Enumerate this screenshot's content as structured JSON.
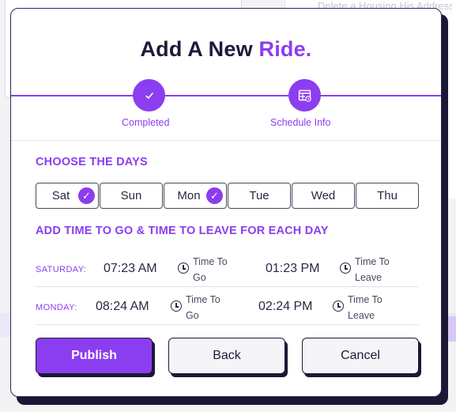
{
  "background": {
    "ghost_text": "Delete a Housing His Address"
  },
  "modal": {
    "title_main": "Add A New",
    "title_accent": "Ride.",
    "steps": [
      {
        "label": "Completed",
        "icon": "check-icon"
      },
      {
        "label": "Schedule Info",
        "icon": "calendar-schedule-icon"
      }
    ],
    "days_heading": "CHOOSE THE DAYS",
    "days": [
      {
        "label": "Sat",
        "selected": true
      },
      {
        "label": "Sun",
        "selected": false
      },
      {
        "label": "Mon",
        "selected": true
      },
      {
        "label": "Tue",
        "selected": false
      },
      {
        "label": "Wed",
        "selected": false
      },
      {
        "label": "Thu",
        "selected": false
      }
    ],
    "times_heading": "ADD TIME TO GO & TIME TO LEAVE FOR EACH DAY",
    "schedule": [
      {
        "day": "SATURDAY:",
        "go_time": "07:23 AM",
        "go_label": "Time To Go",
        "leave_time": "01:23 PM",
        "leave_label": "Time To Leave"
      },
      {
        "day": "MONDAY:",
        "go_time": "08:24 AM",
        "go_label": "Time To Go",
        "leave_time": "02:24 PM",
        "leave_label": "Time To Leave"
      }
    ],
    "buttons": {
      "publish": "Publish",
      "back": "Back",
      "cancel": "Cancel"
    }
  },
  "colors": {
    "accent": "#8b3df0",
    "dark": "#1c1a3a"
  }
}
